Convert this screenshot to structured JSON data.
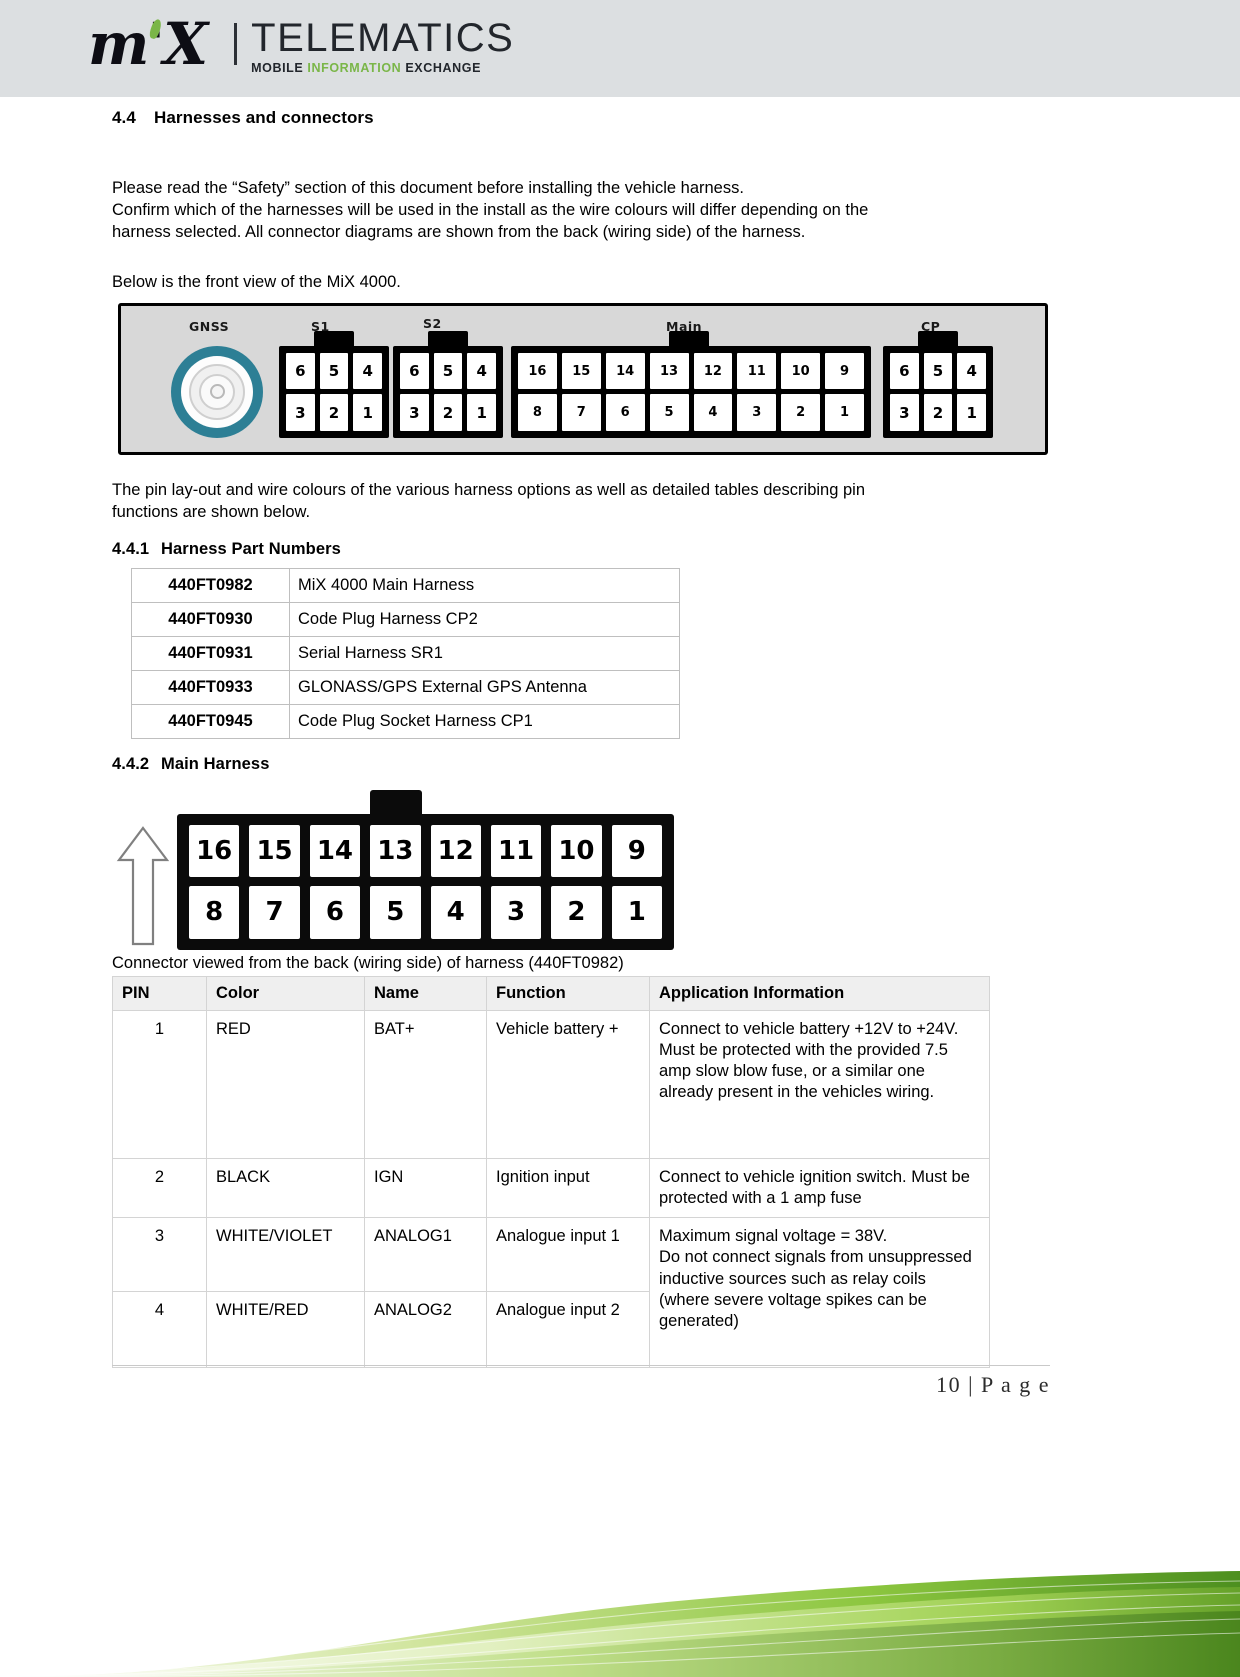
{
  "header": {
    "logo_mark": "m'X",
    "logo_title": "TELEMATICS",
    "logo_sub_1": "MOBILE ",
    "logo_sub_2": "INFORMATION ",
    "logo_sub_3": "EXCHANGE",
    "accent_green": "#7ab648",
    "band_bg": "#dcdfe1"
  },
  "section": {
    "num": "4.4",
    "title": "Harnesses and connectors",
    "intro_line_1": "Please read the “Safety” section of this document before installing the vehicle harness.",
    "intro_line_2": "Confirm which of the harnesses will be used in the install as the wire colours will differ depending on the",
    "intro_line_3": "harness selected. All connector diagrams are shown from the back (wiring side) of the harness.",
    "front_view_lead": "Below is the front view of the MiX 4000.",
    "pinout_line_1": "The pin lay-out and wire colours of the various harness options as well as detailed tables describing pin",
    "pinout_line_2": "functions are shown below."
  },
  "device_diagram": {
    "gnss_label": "GNSS",
    "s1_label": "S1",
    "s2_label": "S2",
    "main_label": "Main",
    "cp_label": "CP",
    "s1_top": [
      "6",
      "5",
      "4"
    ],
    "s1_bottom": [
      "3",
      "2",
      "1"
    ],
    "s2_top": [
      "6",
      "5",
      "4"
    ],
    "s2_bottom": [
      "3",
      "2",
      "1"
    ],
    "main_top": [
      "16",
      "15",
      "14",
      "13",
      "12",
      "11",
      "10",
      "9"
    ],
    "main_bottom": [
      "8",
      "7",
      "6",
      "5",
      "4",
      "3",
      "2",
      "1"
    ],
    "cp_top": [
      "6",
      "5",
      "4"
    ],
    "cp_bottom": [
      "3",
      "2",
      "1"
    ],
    "gnss_ring_color": "#2d7f95"
  },
  "part_numbers_section": {
    "num": "4.4.1",
    "title": "Harness Part Numbers",
    "rows": [
      {
        "part": "440FT0982",
        "description": "MiX 4000 Main Harness"
      },
      {
        "part": "440FT0930",
        "description": "Code Plug Harness CP2"
      },
      {
        "part": "440FT0931",
        "description": "Serial Harness SR1"
      },
      {
        "part": "440FT0933",
        "description": "GLONASS/GPS External GPS Antenna"
      },
      {
        "part": "440FT0945",
        "description": "Code Plug Socket Harness CP1"
      }
    ]
  },
  "main_harness_section": {
    "num": "4.4.2",
    "title": "Main Harness",
    "connector_top": [
      "16",
      "15",
      "14",
      "13",
      "12",
      "11",
      "10",
      "9"
    ],
    "connector_bottom": [
      "8",
      "7",
      "6",
      "5",
      "4",
      "3",
      "2",
      "1"
    ],
    "caption": "Connector viewed from the back (wiring side) of harness (440FT0982)",
    "table": {
      "headers": [
        "PIN",
        "Color",
        "Name",
        "Function",
        "Application Information"
      ],
      "rows": [
        {
          "pin": "1",
          "color": "RED",
          "name": "BAT+",
          "function": "Vehicle battery +",
          "application": "Connect to vehicle battery +12V to +24V.\nMust be protected with the provided 7.5 amp slow blow fuse, or a similar one already present in the vehicles wiring."
        },
        {
          "pin": "2",
          "color": "BLACK",
          "name": "IGN",
          "function": "Ignition input",
          "application": "Connect to vehicle ignition switch. Must be protected with a 1 amp fuse"
        },
        {
          "pin": "3",
          "color": "WHITE/VIOLET",
          "name": "ANALOG1",
          "function": "Analogue input 1",
          "application": "Maximum signal voltage = 38V.\nDo not connect signals from unsuppressed inductive sources such as relay coils (where severe voltage spikes can be generated)"
        },
        {
          "pin": "4",
          "color": "WHITE/RED",
          "name": "ANALOG2",
          "function": "Analogue input 2",
          "application": ""
        }
      ]
    }
  },
  "footer": {
    "page_label": "10 | P a g e"
  }
}
